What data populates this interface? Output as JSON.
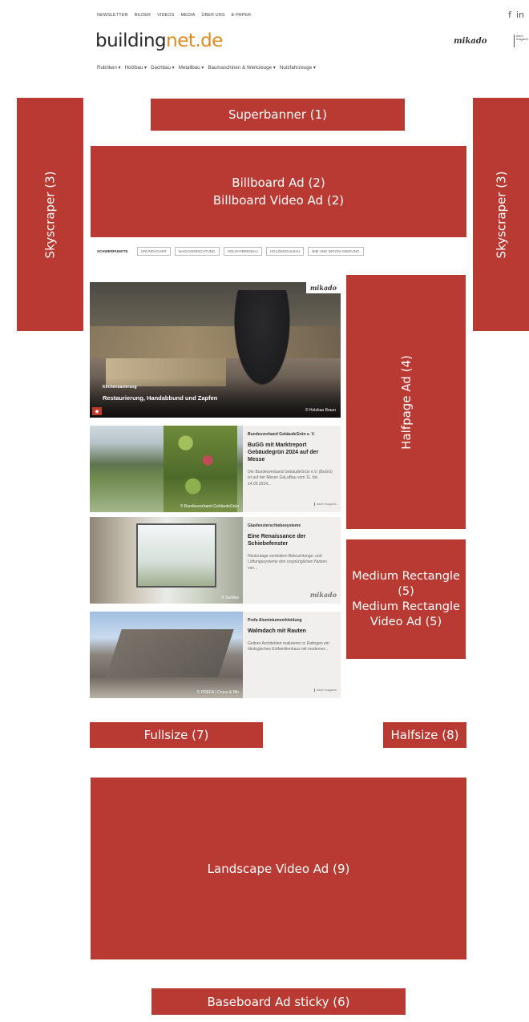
{
  "topnav": {
    "items": [
      "NEWSLETTER",
      "BILDER",
      "VIDEOS",
      "MEDIA",
      "ÜBER UNS",
      "E-PAPER"
    ]
  },
  "social": {
    "facebook": "f",
    "linkedin": "in"
  },
  "logo": {
    "part1": "building",
    "part2": "net.de"
  },
  "partners": {
    "mikado": "mikado",
    "dach": "dach magazin"
  },
  "catnav": {
    "items": [
      "Rubriken ▾",
      "Holzbau ▾",
      "Dachbau ▾",
      "Metallbau ▾",
      "Baumaschinen & Werkzeuge ▾",
      "Nutzfahrzeuge ▾"
    ]
  },
  "schwerpunkte": {
    "label": "SCHWERPUNKTE",
    "tags": [
      "GRÜNDÄCHER",
      "NACHVERDICHTUNG",
      "HOLZHYBRIDBAU",
      "HOLZMODULBAU",
      "BIM UND DIGITALISIERUNG"
    ]
  },
  "ads": {
    "superbanner": "Superbanner (1)",
    "billboard_1": "Billboard Ad (2)",
    "billboard_2": "Billboard Video Ad (2)",
    "skyscraper_left": "Skyscraper (3)",
    "skyscraper_right": "Skyscraper (3)",
    "halfpage": "Halfpage Ad (4)",
    "medrect_1": "Medium Rectangle (5)",
    "medrect_2": "Medium Rectangle Video Ad (5)",
    "fullsize": "Fullsize (7)",
    "halfsize": "Halfsize (8)",
    "landscape": "Landscape Video Ad (9)",
    "baseboard": "Baseboard Ad sticky (6)"
  },
  "hero": {
    "brand": "mikado",
    "kicker": "Kirchensanierung",
    "title": "Restaurierung, Handabbund und Zapfen",
    "credit": "© Holzbau Braun"
  },
  "cards": [
    {
      "kicker": "Bundesverband GebäudeGrün e. V.",
      "title": "BuGG mit Marktreport Gebäudegrün 2024 auf der Messe",
      "teaser": "Der Bundesverband GebäudeGrün e.V. (BuGG) ist auf der Messe GaLaBau vom 11. bis 14.09.2024...",
      "credit": "© Bundesverband GebäudeGrün",
      "brand": "dach magazin"
    },
    {
      "kicker": "Glasfensterschiebesysteme",
      "title": "Eine Renaissance der Schiebefenster",
      "teaser": "Heutzutage verändern Beleuchtungs- und Lüftungssysteme den ursprünglichen Nutzen von...",
      "credit": "© Sunflex",
      "brand": "mikado"
    },
    {
      "kicker": "Prefa Aluminiumverkleidung",
      "title": "Walmdach mit Rauten",
      "teaser": "Geitner Architekten realisieren in Ratingen ein ökologisches Einfamilienhaus mit moderner...",
      "credit": "© PREFA | Croce & Wir",
      "brand": "dach magazin"
    }
  ]
}
